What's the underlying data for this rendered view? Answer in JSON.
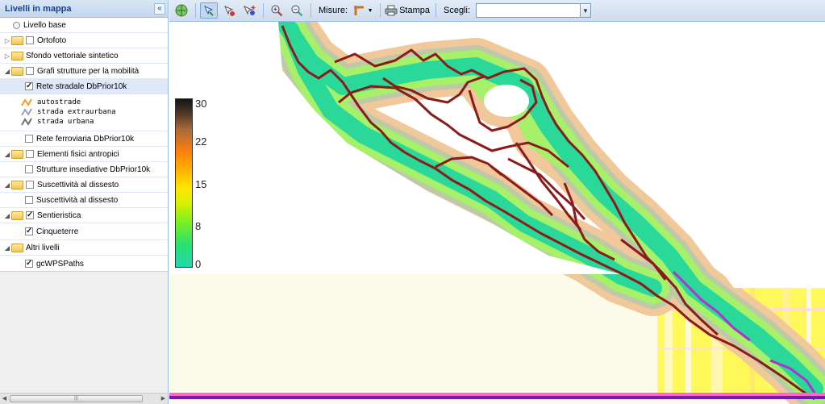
{
  "left_panel": {
    "title": "Livelli in mappa",
    "collapse_icon": "double-chevron-left-icon",
    "layers": {
      "livello_base": "Livello base",
      "ortofoto": "Ortofoto",
      "sfondo": "Sfondo vettoriale sintetico",
      "grafi": "Grafi strutture per la mobilità",
      "rete_stradale": "Rete stradale DbPrior10k",
      "legend": [
        "autostrade",
        "strada extraurbana",
        "strada urbana"
      ],
      "legend_colors": [
        "#f0a020",
        "#9aa0c8",
        "#707070"
      ],
      "rete_ferroviaria": "Rete ferroviaria DbPrior10k",
      "elementi_fisici": "Elementi fisici antropici",
      "strutture": "Strutture insediative DbPrior10k",
      "suscettivita_group": "Suscettività  al dissesto",
      "suscettivita_layer": "Suscettività  al dissesto",
      "sentieristica": "Sentieristica",
      "cinqueterre": "Cinqueterre",
      "altri_livelli": "Altri livelli",
      "gcwpspaths": "gcWPSPaths"
    }
  },
  "toolbar": {
    "misure_label": "Misure:",
    "stampa_label": "Stampa",
    "scegli_label": "Scegli:",
    "scegli_value": ""
  },
  "map": {
    "colorbar_ticks": [
      "30",
      "22",
      "15",
      "8",
      "0"
    ],
    "path_color": "#8b1a1a",
    "ramp": [
      "#21d6b0",
      "#7bf020",
      "#ffe700",
      "#f87c10",
      "#141414"
    ]
  }
}
